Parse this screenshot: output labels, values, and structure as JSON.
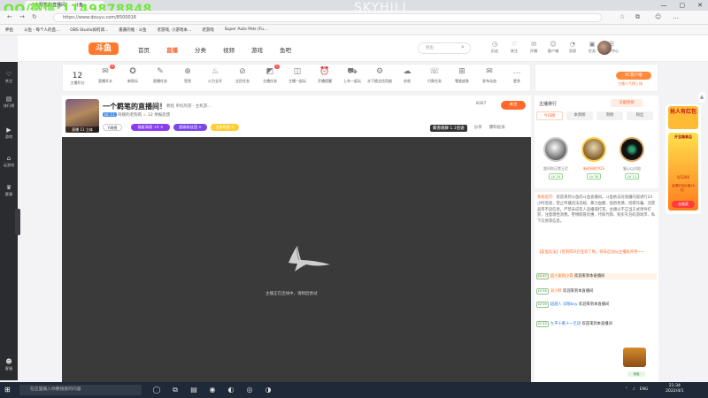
{
  "browser": {
    "tab_title": "一个羁笔的直播间！ - 斗鱼",
    "watermark": "QQ/微信:1149878848",
    "overlay_text": "SKYHILL",
    "url": "https://www.douyu.com/8500016",
    "window_controls": [
      "—",
      "▢",
      "✕"
    ],
    "bookmarks": [
      "养鱼",
      "斗鱼 - 每个人的直...",
      "OBS Studio如何调...",
      "嘉嘉的瓶 · 斗鱼",
      "老游戏, 小游戏本...",
      "老游戏",
      "Super Auto Pets (Fu..."
    ]
  },
  "header": {
    "logo": "斗鱼",
    "nav": [
      "首页",
      "直播",
      "分类",
      "视频",
      "游戏",
      "鱼吧"
    ],
    "nav_active": "直播",
    "search_placeholder": "搜鱼",
    "top_icons": [
      {
        "icon": "◷",
        "label": "历史"
      },
      {
        "icon": "♡",
        "label": "关注"
      },
      {
        "icon": "✉",
        "label": "开播"
      },
      {
        "icon": "☺",
        "label": "客户端"
      },
      {
        "icon": "◔",
        "label": "消息"
      },
      {
        "icon": "▣",
        "label": "任务"
      },
      {
        "icon": "☰",
        "label": "用户中心"
      }
    ]
  },
  "sidebar": [
    {
      "icon": "♡",
      "label": "关注"
    },
    {
      "icon": "▤",
      "label": "排行榜"
    },
    {
      "icon": "▶",
      "label": "游戏"
    },
    {
      "icon": "⌂",
      "label": "云游戏"
    },
    {
      "icon": "♛",
      "label": "赛事"
    },
    {
      "icon": "☻",
      "label": "客服"
    }
  ],
  "toolbar": {
    "level_num": "12",
    "level_label": "主播积分",
    "tools": [
      {
        "icon": "✉",
        "label": "直播开水",
        "badge": "9"
      },
      {
        "icon": "✪",
        "label": "新鱼玩"
      },
      {
        "icon": "✎",
        "label": "直播任务"
      },
      {
        "icon": "⊕",
        "label": "签到"
      },
      {
        "icon": "♨",
        "label": "火力全开"
      },
      {
        "icon": "⊘",
        "label": "全民任务"
      },
      {
        "icon": "◩",
        "label": "主播任务",
        "badge": "1"
      },
      {
        "icon": "◫",
        "label": "主播一起玩"
      },
      {
        "icon": "⏰",
        "label": "开播提醒"
      },
      {
        "icon": "⛟",
        "label": "上车一起玩"
      },
      {
        "icon": "⚙",
        "label": "水下植全信用度"
      },
      {
        "icon": "☁",
        "label": "庆祝"
      },
      {
        "icon": "☏",
        "label": "付款任务"
      },
      {
        "icon": "⊞",
        "label": "零度皮肤"
      },
      {
        "icon": "✉",
        "label": "发布动态"
      },
      {
        "icon": "…",
        "label": "更多"
      }
    ],
    "pc_button": "PC客户端",
    "pc_sub": "主播人气榜上线"
  },
  "room": {
    "title": "一个羁笔的直播间！",
    "tags": "教程  单机热游 · 主机游...",
    "level": "LV. 11",
    "anchor": "阿刚的老狗肉",
    "fans": "12",
    "report": "举报反馈",
    "thumb_caption": "直播 11  立体",
    "badges": [
      {
        "text": "Y周榜",
        "color": "#ffffff",
        "fg": "#333"
      },
      {
        "text": "福星高照 +4 ✕",
        "color": "#8a3df0",
        "fg": "#fff"
      },
      {
        "text": "超级粉丝团 ✕",
        "color": "#7a46e8",
        "fg": "#fff"
      },
      {
        "text": "当前数量 ✕",
        "color": "#ffcc33",
        "fg": "#fff"
      }
    ],
    "hot": "8367",
    "follow": "关注",
    "tools": [
      "聚香跳舞 1.1倍速",
      "分享",
      "爆料投诉"
    ]
  },
  "player": {
    "message": "主播正在连线中，请稍后尝试"
  },
  "rank": {
    "title": "主播排行",
    "gift": "贡献周榜",
    "tabs": [
      "今日榜",
      "本周榜",
      "周榜",
      "粉丝"
    ],
    "people": [
      {
        "name": "超问你正常王尼",
        "level": "LV 24"
      },
      {
        "name": "新的网的YOS",
        "level": "LV 35"
      },
      {
        "name": "狠心以对陪",
        "level": "LV 11"
      }
    ]
  },
  "chat": {
    "system_label": "系统提示：",
    "system": "欢迎来到斗鱼的斗鱼直播间。斗鱼依法对直播内容进行24小时巡查，禁止传播违法违规、暴力血腥、低俗色情、招嫖诈骗、违禁品等不良信息。严禁未成年人直播或打赏。主播以不正当方式诱导打赏，注意理性消费。警惕假冒优惠、代练代购、购买礼包码游戏币、私下交易等信息。",
    "notice": "【鲨鱼玩法】(签到得开启狂欢了啦，快去启动从主播处开吧~~",
    "lines": [
      {
        "lv": "LV 47",
        "user": "追人家的小哥",
        "text": "欢迎来到本直播间",
        "hl": true
      },
      {
        "lv": "LV 54",
        "user": "凤小聆",
        "text": "欢迎来到本直播间",
        "hl": false
      },
      {
        "lv": "LV 59",
        "user": "超越人 没眼boy",
        "text": "欢迎来到本直播间",
        "hl": false
      },
      {
        "lv": "LV 43",
        "user": "九平十看十一无语",
        "text": "欢迎来到本直播间",
        "hl": false
      }
    ],
    "chest_btn": "领取"
  },
  "promo": {
    "title": "抢人有红包",
    "subtitle": "开宝箱拿品",
    "progress": "0/1200",
    "desc": "赢得红包价值18元！",
    "button": "去抽奖"
  },
  "taskbar": {
    "search": "在这里输入你要搜索的内容",
    "apps": [
      "◯",
      "⧉",
      "▤",
      "◉",
      "◐",
      "◎",
      "◑"
    ],
    "tray": [
      "⌃",
      "♪",
      "ENG"
    ],
    "time": "21:34",
    "date": "2022/4/1"
  }
}
